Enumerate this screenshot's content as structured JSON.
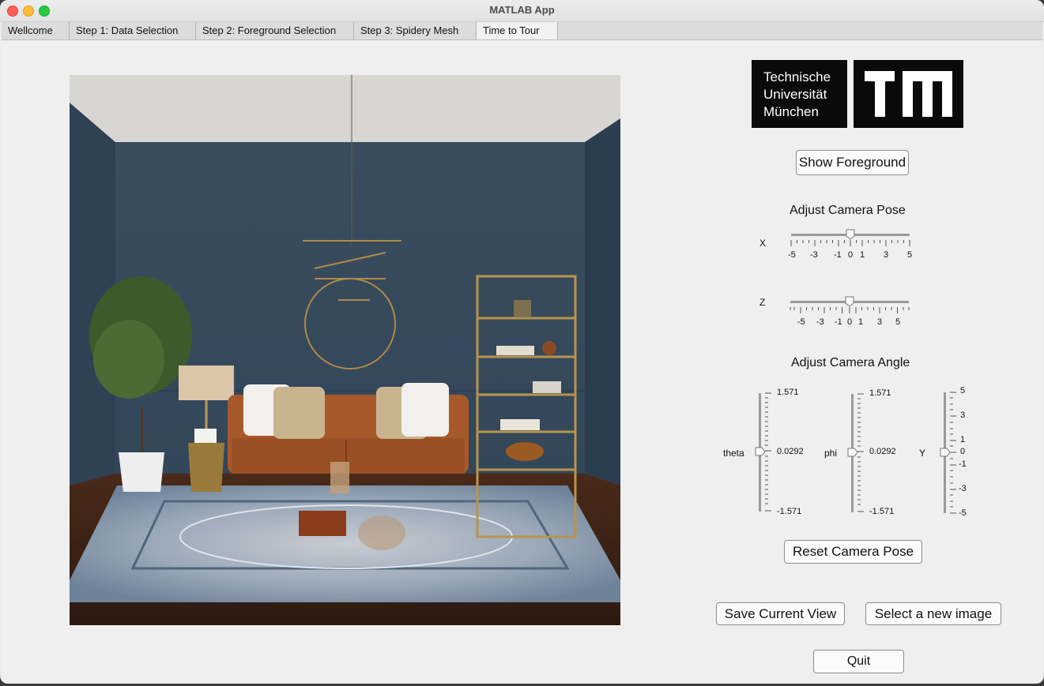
{
  "window": {
    "title": "MATLAB App"
  },
  "tabs": [
    {
      "label": "Wellcome",
      "active": false
    },
    {
      "label": "Step 1: Data Selection",
      "active": false
    },
    {
      "label": "Step 2: Foreground Selection",
      "active": false
    },
    {
      "label": "Step 3: Spidery Mesh",
      "active": false
    },
    {
      "label": "Time to Tour",
      "active": true
    }
  ],
  "logo": {
    "line1": "Technische",
    "line2": "Universität",
    "line3": "München",
    "mark": "TUM"
  },
  "buttons": {
    "show_foreground": "Show Foreground",
    "reset_camera_pose": "Reset Camera Pose",
    "save_current_view": "Save Current View",
    "select_new_image": "Select a new image",
    "quit": "Quit"
  },
  "camera_pose": {
    "heading": "Adjust Camera Pose",
    "x": {
      "label": "X",
      "value": 0,
      "min": -5,
      "max": 5,
      "tick_labels": [
        "-5",
        "-3",
        "-1",
        "0",
        "1",
        "3",
        "5"
      ]
    },
    "z": {
      "label": "Z",
      "value": 0,
      "min": -5,
      "max": 5,
      "tick_labels": [
        "-5",
        "-3",
        "-1",
        "0",
        "1",
        "3",
        "5"
      ]
    }
  },
  "camera_angle": {
    "heading": "Adjust Camera Angle",
    "theta": {
      "label": "theta",
      "value": 0.0292,
      "tick_labels": [
        "1.571",
        "0.0292",
        "-1.571"
      ]
    },
    "phi": {
      "label": "phi",
      "value": 0.0292,
      "tick_labels": [
        "1.571",
        "0.0292",
        "-1.571"
      ]
    },
    "y": {
      "label": "Y",
      "value": 0,
      "tick_labels": [
        "5",
        "3",
        "1",
        "0",
        "-1",
        "-3",
        "-5"
      ]
    }
  },
  "icons": {
    "close": "close-dot-icon",
    "minimize": "minimize-dot-icon",
    "maximize": "maximize-dot-icon"
  },
  "colors": {
    "window_bg": "#efefef",
    "logo_bg": "#0a0a0a",
    "wall": "#3a4c5c",
    "sofa": "#a8592a"
  }
}
